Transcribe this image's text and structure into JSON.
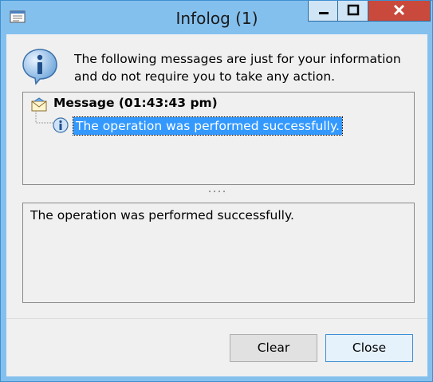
{
  "window": {
    "title": "Infolog (1)",
    "app_icon": "infolog-app-icon",
    "controls": [
      "minimize-icon",
      "maximize-icon",
      "close-icon"
    ]
  },
  "header": {
    "icon": "info-icon",
    "text": "The following messages are just for your information and do not require you to take any action."
  },
  "tree": {
    "root": {
      "icon": "message-envelope-icon",
      "label": "Message (01:43:43 pm)"
    },
    "child": {
      "icon": "info-icon",
      "label": "The operation was performed successfully.",
      "selected": true
    }
  },
  "detail": {
    "text": "The operation was performed successfully."
  },
  "buttons": {
    "clear": "Clear",
    "close": "Close"
  },
  "colors": {
    "titlebar": "#84c0ee",
    "selection": "#3399ff",
    "close_button": "#c94a3c"
  }
}
